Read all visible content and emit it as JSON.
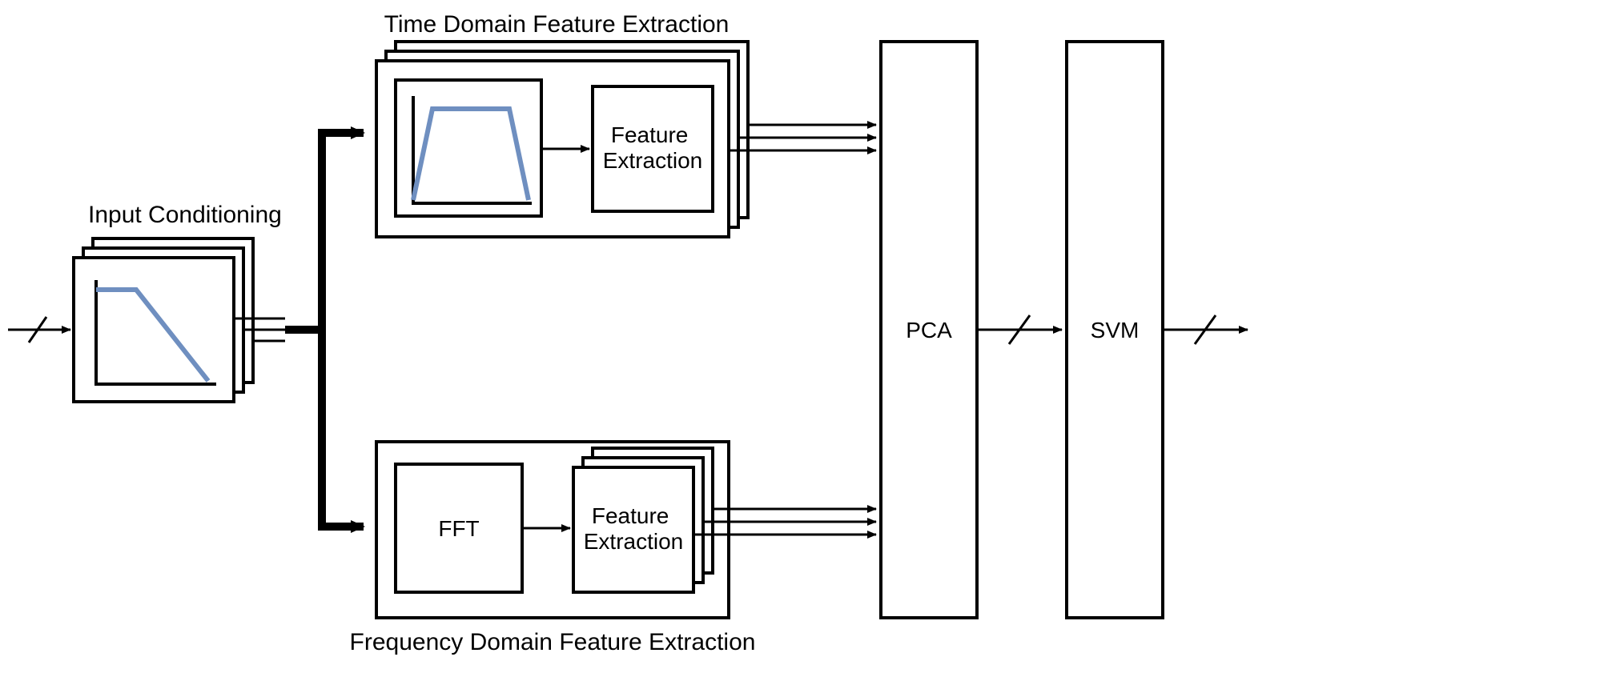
{
  "labels": {
    "input_conditioning": "Input Conditioning",
    "time_domain_title": "Time Domain Feature Extraction",
    "freq_domain_title": "Frequency Domain Feature Extraction",
    "feature_extraction": "Feature Extraction",
    "fft": "FFT",
    "pca": "PCA",
    "svm": "SVM"
  },
  "colors": {
    "stroke": "#000000",
    "signal": "#6f8fc0"
  }
}
